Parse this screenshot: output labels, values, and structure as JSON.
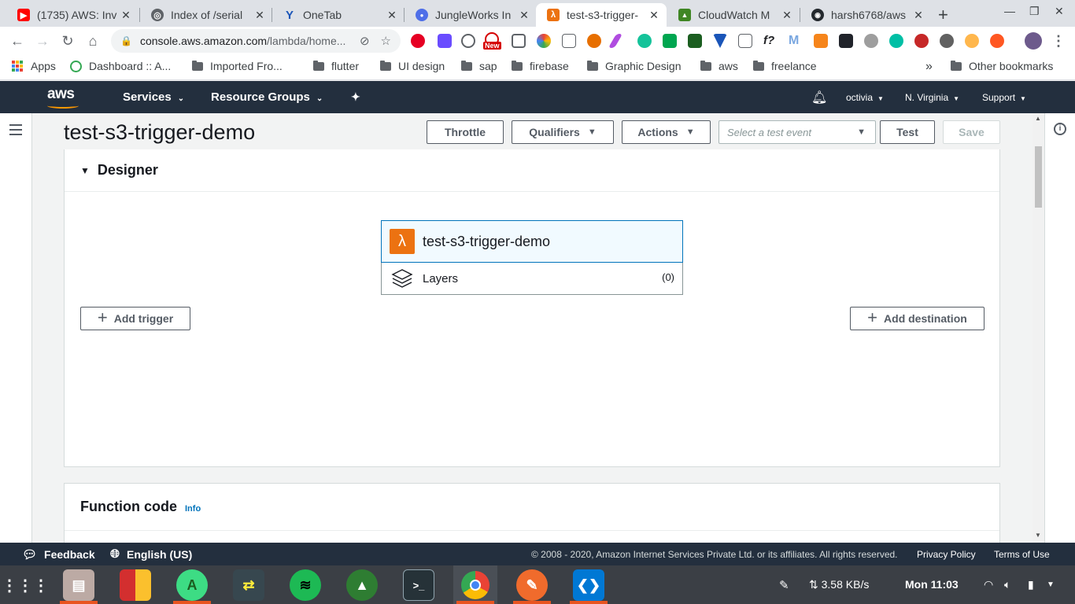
{
  "browser": {
    "tabs": [
      {
        "title": "(1735) AWS: Inv",
        "favicon_color": "#ff0000",
        "favicon_glyph": "▶"
      },
      {
        "title": "Index of /serial",
        "favicon_color": "#5f6368",
        "favicon_glyph": "◎"
      },
      {
        "title": "OneTab",
        "favicon_color": "#1a55b8",
        "favicon_glyph": "Y"
      },
      {
        "title": "JungleWorks In",
        "favicon_color": "#4f6fe8",
        "favicon_glyph": "●"
      },
      {
        "title": "test-s3-trigger-",
        "favicon_color": "#ec7211",
        "favicon_glyph": "λ",
        "active": true
      },
      {
        "title": "CloudWatch M",
        "favicon_color": "#3f8624",
        "favicon_glyph": "▲"
      },
      {
        "title": "harsh6768/aws",
        "favicon_color": "#24292e",
        "favicon_glyph": "◉"
      }
    ],
    "new_tab_glyph": "+",
    "url_host": "console.aws.amazon.com",
    "url_path": "/lambda/home...",
    "bookmarks": [
      "Apps",
      "Dashboard :: A...",
      "Imported Fro...",
      "flutter",
      "UI design",
      "sap",
      "firebase",
      "Graphic Design",
      "aws",
      "freelance"
    ],
    "bookmarks_overflow": "»",
    "other_bookmarks": "Other bookmarks",
    "new_badge": "New"
  },
  "aws_header": {
    "logo": "aws",
    "services": "Services",
    "resource_groups": "Resource Groups",
    "user": "octivia",
    "region": "N. Virginia",
    "support": "Support"
  },
  "page": {
    "title": "test-s3-trigger-demo",
    "buttons": {
      "throttle": "Throttle",
      "qualifiers": "Qualifiers",
      "actions": "Actions",
      "test": "Test",
      "save": "Save"
    },
    "test_event_placeholder": "Select a test event"
  },
  "designer": {
    "heading": "Designer",
    "function_name": "test-s3-trigger-demo",
    "layers_label": "Layers",
    "layers_count": "(0)",
    "add_trigger": "Add trigger",
    "add_destination": "Add destination"
  },
  "function_code": {
    "heading": "Function code",
    "info": "Info"
  },
  "aws_footer": {
    "feedback": "Feedback",
    "language": "English (US)",
    "copyright": "© 2008 - 2020, Amazon Internet Services Private Ltd. or its affiliates. All rights reserved.",
    "privacy": "Privacy Policy",
    "terms": "Terms of Use"
  },
  "taskbar": {
    "network_speed": "3.58 KB/s",
    "clock": "Mon 11:03"
  },
  "colors": {
    "aws_dark": "#232f3e",
    "aws_orange": "#ec7211",
    "link_blue": "#0073bb"
  }
}
